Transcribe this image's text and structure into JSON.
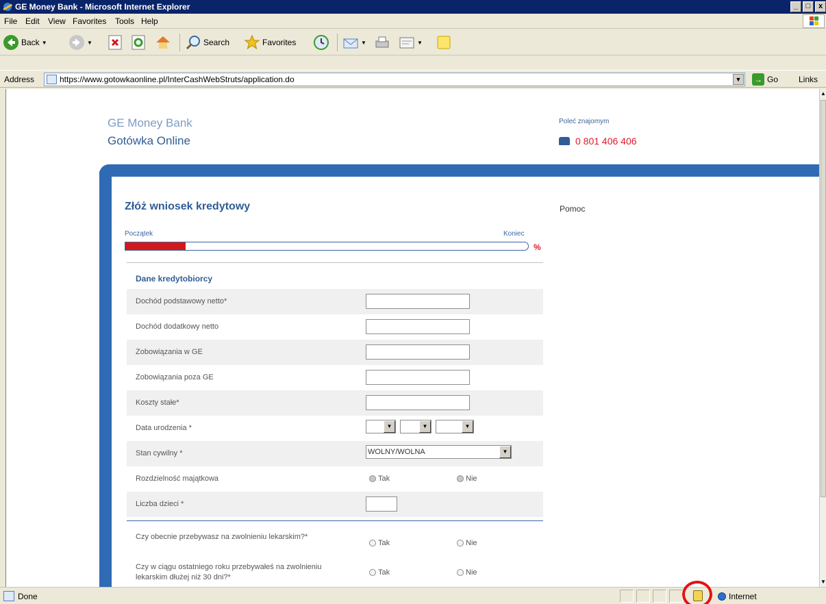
{
  "window": {
    "title": "GE Money Bank - Microsoft Internet Explorer",
    "btn_min": "_",
    "btn_max": "□",
    "btn_close": "x"
  },
  "menu": {
    "items": [
      "File",
      "Edit",
      "View",
      "Favorites",
      "Tools",
      "Help"
    ]
  },
  "toolbar": {
    "back": "Back",
    "search": "Search",
    "favorites": "Favorites"
  },
  "address": {
    "label": "Address",
    "url": "https://www.gotowkaonline.pl/InterCashWebStruts/application.do",
    "go": "Go",
    "links": "Links"
  },
  "page": {
    "brand_line1": "GE Money Bank",
    "brand_line2": "Gotówka Online",
    "recommend": "Poleć znajomym",
    "phone": "0 801 406 406",
    "title": "Złóż wniosek kredytowy",
    "help": "Pomoc",
    "progress": {
      "start_label": "Początek",
      "end_label": "Koniec",
      "percent_symbol": "%",
      "fraction": 0.15
    },
    "section_title": "Dane kredytobiorcy",
    "fields": [
      {
        "label": "Dochód podstawowy netto*",
        "value": ""
      },
      {
        "label": "Dochód dodatkowy netto",
        "value": ""
      },
      {
        "label": "Zobowiązania w GE",
        "value": ""
      },
      {
        "label": "Zobowiązania poza GE",
        "value": ""
      },
      {
        "label": "Koszty stałe*",
        "value": ""
      }
    ],
    "birth_date_label": "Data urodzenia *",
    "marital_label": "Stan cywilny *",
    "marital_value": "WOLNY/WOLNA",
    "property_label": "Rozdzielność majątkowa",
    "children_label": "Liczba dzieci *",
    "radio_yes": "Tak",
    "radio_no": "Nie",
    "question1": "Czy obecnie przebywasz na zwolnieniu lekarskim?*",
    "question2": "Czy w ciągu ostatniego roku przebywałeś na zwolnieniu lekarskim dłużej niż 30 dni?*"
  },
  "status": {
    "text": "Done",
    "zone": "Internet"
  },
  "colors": {
    "brand_blue": "#2f6ab5",
    "progress_red": "#d4181a",
    "annotation_red": "#e41212"
  }
}
